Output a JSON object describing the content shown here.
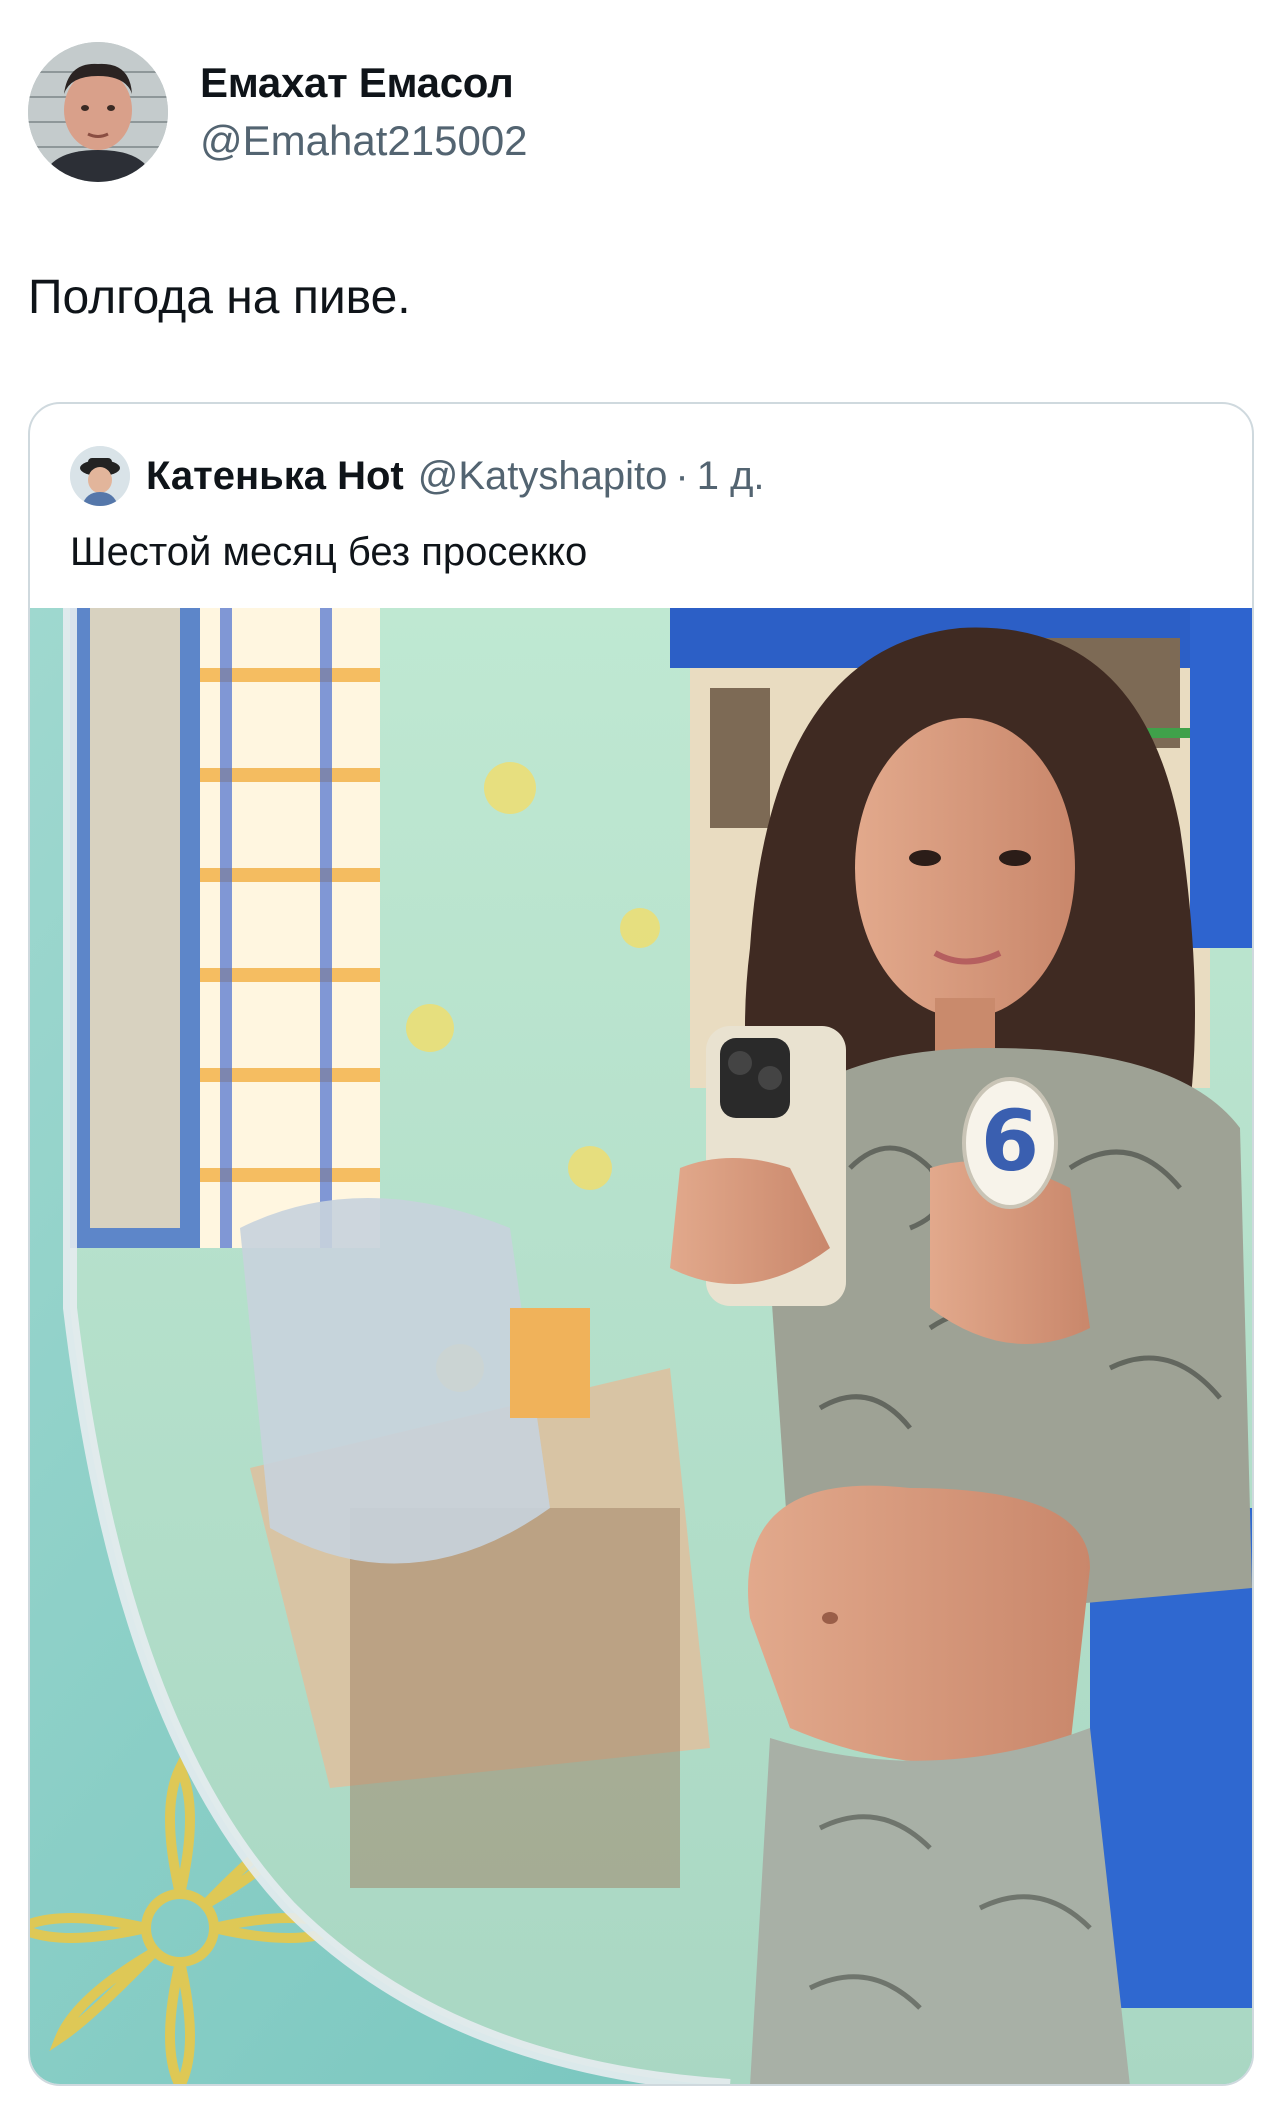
{
  "tweet": {
    "author": {
      "display_name": "Емахат Емасол",
      "handle": "@Emahat215002"
    },
    "text": "Полгода на пиве."
  },
  "quoted_tweet": {
    "author": {
      "display_name": "Катенька Hot",
      "handle": "@Katyshapito"
    },
    "separator": "·",
    "time": "1 д.",
    "text": "Шестой месяц без просекко",
    "photo": {
      "candle_digit": "6"
    }
  }
}
